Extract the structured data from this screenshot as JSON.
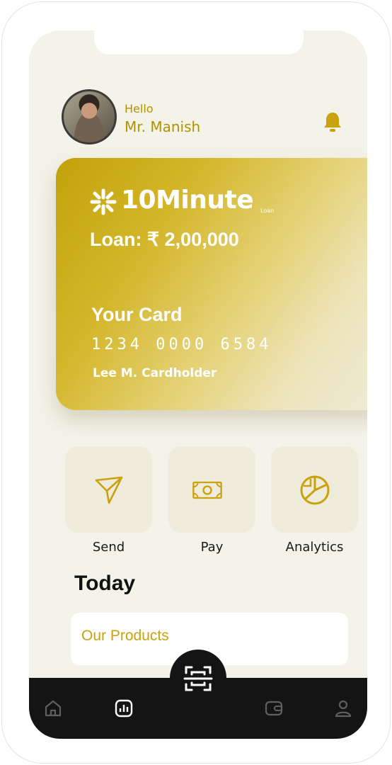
{
  "header": {
    "greeting": "Hello",
    "user_name": "Mr. Manish",
    "notification_icon": "bell-icon"
  },
  "card": {
    "brand": "10Minute",
    "brand_sub": "Loan",
    "loan_text": "Loan: ₹ 2,00,000",
    "label": "Your Card",
    "number": "1234 0000 6584",
    "holder": "Lee M. Cardholder"
  },
  "actions": [
    {
      "label": "Send",
      "icon": "send-icon"
    },
    {
      "label": "Pay",
      "icon": "banknote-icon"
    },
    {
      "label": "Analytics",
      "icon": "pie-chart-icon"
    }
  ],
  "section": {
    "title": "Today"
  },
  "products": {
    "label": "Our Products"
  },
  "tabbar": {
    "items": [
      "home-icon",
      "stats-icon",
      "scan-icon",
      "wallet-icon",
      "profile-icon"
    ]
  },
  "colors": {
    "accent": "#c9a20e",
    "background": "#f4f3e9",
    "tabbar": "#141414"
  }
}
